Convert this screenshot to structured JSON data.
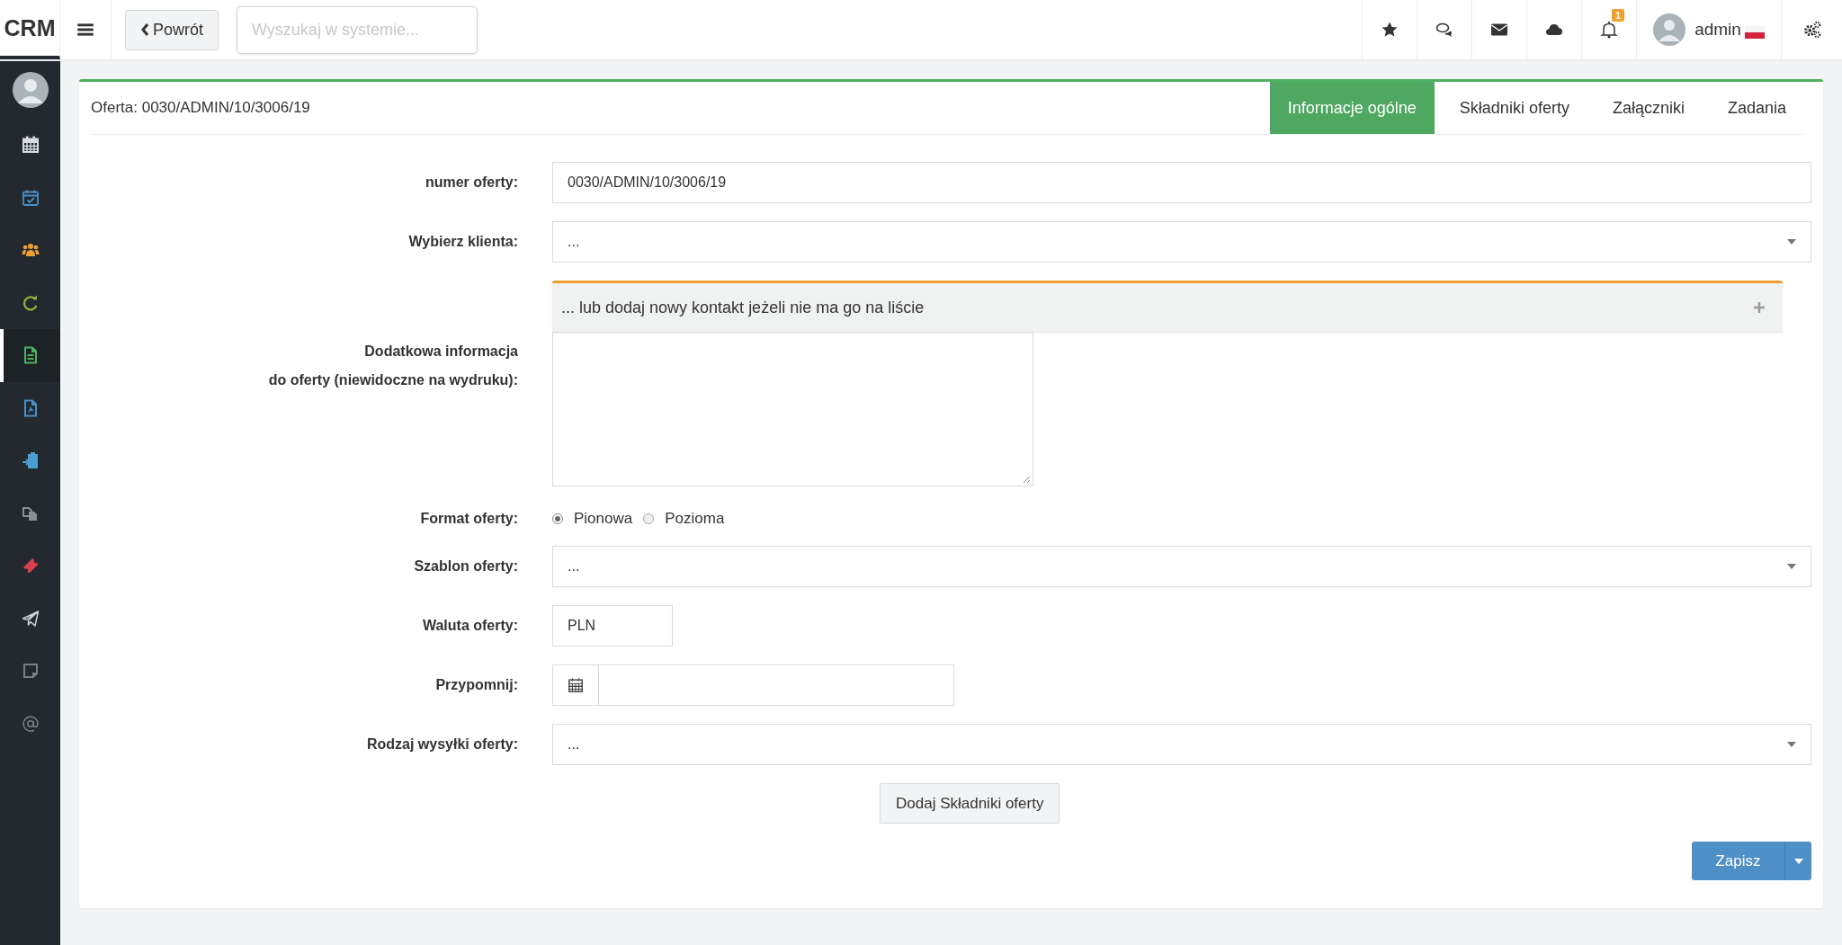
{
  "topbar": {
    "logo": "CRM",
    "back_button": "Powrót",
    "search": {
      "placeholder": "Wyszukaj w systemie..."
    },
    "notifications_badge": "1",
    "user_name": "admin"
  },
  "sidebar": {
    "items": [
      {
        "kind": "avatar",
        "selected": false
      },
      {
        "kind": "calendar",
        "color": "#d8dcdf",
        "selected": false
      },
      {
        "kind": "calendar-check",
        "color": "#4a90c8",
        "selected": false
      },
      {
        "kind": "users",
        "color": "#f0a030",
        "selected": false
      },
      {
        "kind": "refresh",
        "color": "#8fb03a",
        "selected": false
      },
      {
        "kind": "file",
        "color": "#4caf62",
        "selected": true
      },
      {
        "kind": "pdf",
        "color": "#4a8fc8",
        "selected": false
      },
      {
        "kind": "clipboard",
        "color": "#4a9fd0",
        "selected": false
      },
      {
        "kind": "copy",
        "color": "#8a8f94",
        "selected": false
      },
      {
        "kind": "ticket",
        "color": "#d94050",
        "selected": false
      },
      {
        "kind": "send",
        "color": "#d0d3d6",
        "selected": false
      },
      {
        "kind": "note",
        "color": "#7a7f84",
        "selected": false
      },
      {
        "kind": "at",
        "color": "#7a7f84",
        "selected": false
      }
    ]
  },
  "card": {
    "title": "Oferta: 0030/ADMIN/10/3006/19",
    "tabs": [
      {
        "label": "Informacje ogólne",
        "selected": true
      },
      {
        "label": "Składniki oferty",
        "selected": false
      },
      {
        "label": "Załączniki",
        "selected": false
      },
      {
        "label": "Zadania",
        "selected": false
      }
    ]
  },
  "form": {
    "fields": [
      {
        "kind": "text",
        "label": "numer oferty:",
        "value": "0030/ADMIN/10/3006/19"
      },
      {
        "kind": "select",
        "label": "Wybierz klienta:",
        "value": "..."
      },
      {
        "kind": "panel",
        "title": "... lub dodaj nowy kontakt jeżeli nie ma go na liście"
      },
      {
        "kind": "textarea",
        "label_lines": [
          "Dodatkowa informacja",
          "do oferty (niewidoczne na wydruku):"
        ]
      },
      {
        "kind": "radio",
        "label": "Format oferty:",
        "options": [
          {
            "label": "Pionowa",
            "selected": true
          },
          {
            "label": "Pozioma",
            "selected": false
          }
        ]
      },
      {
        "kind": "select",
        "label": "Szablon oferty:",
        "value": "..."
      },
      {
        "kind": "short",
        "label": "Waluta oferty:",
        "value": "PLN"
      },
      {
        "kind": "date",
        "label": "Przypomnij:"
      },
      {
        "kind": "select",
        "label": "Rodzaj wysyłki oferty:",
        "value": "..."
      }
    ],
    "add_button": "Dodaj Składniki oferty",
    "save_button": "Zapisz"
  }
}
